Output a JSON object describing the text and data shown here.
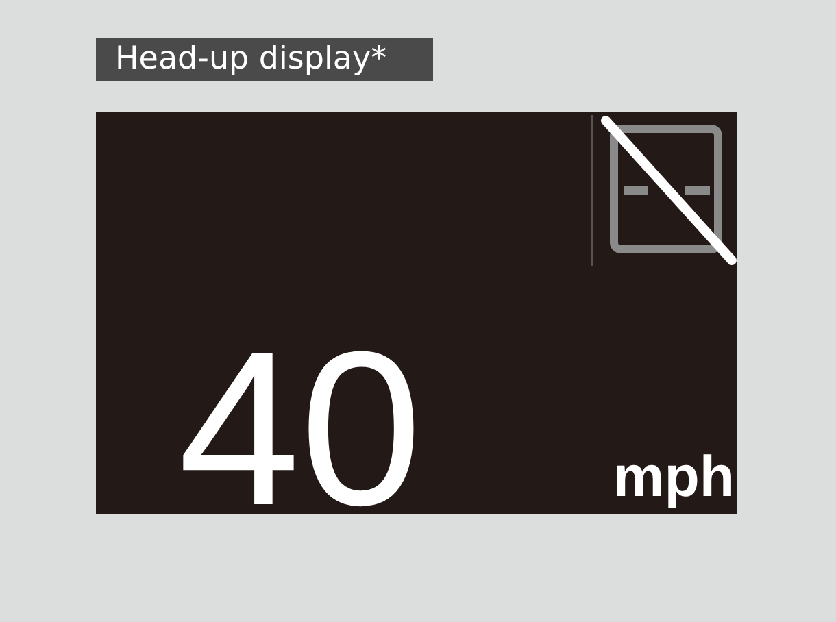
{
  "title": "Head-up display*",
  "display": {
    "speed": "40",
    "unit": "mph"
  }
}
